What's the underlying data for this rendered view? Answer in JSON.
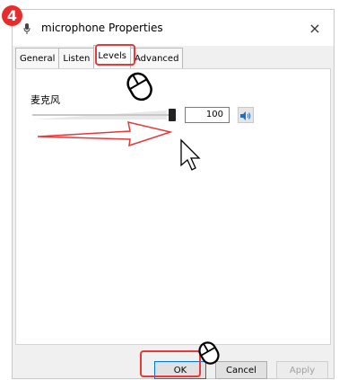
{
  "annotation": {
    "step_number": "4",
    "colors": {
      "badge": "#ea2b2b",
      "highlight": "#e33b3b",
      "arrow": "#e33b3b"
    }
  },
  "window": {
    "title": "microphone Properties",
    "title_icon": "microphone-icon",
    "close_label": "×"
  },
  "tabs": [
    {
      "label": "General",
      "active": false
    },
    {
      "label": "Listen",
      "active": false
    },
    {
      "label": "Levels",
      "active": true
    },
    {
      "label": "Advanced",
      "active": false
    }
  ],
  "levels": {
    "device_label": "麦克风",
    "level_value": "100",
    "slider_level": 1.0,
    "speaker_icon": "speaker-icon"
  },
  "buttons": {
    "ok": "OK",
    "cancel": "Cancel",
    "apply": "Apply"
  }
}
